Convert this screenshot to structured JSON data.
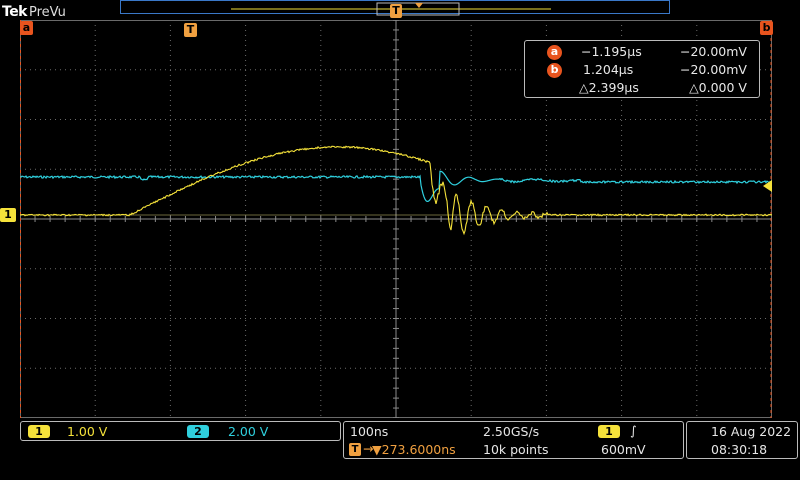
{
  "header": {
    "brand": "Tek",
    "mode": "PreVu"
  },
  "markers": {
    "cursor_a": "a",
    "cursor_b": "b",
    "trigger": "T",
    "ch1_ground": "1"
  },
  "cursors": {
    "a": {
      "label": "a",
      "time": "−1.195µs",
      "value": "−20.00mV"
    },
    "b": {
      "label": "b",
      "time": "1.204µs",
      "value": "−20.00mV"
    },
    "delta": {
      "time": "△2.399µs",
      "value": "△0.000 V"
    }
  },
  "channels": [
    {
      "id": "1",
      "scale": "1.00 V",
      "color": "#f5e23a"
    },
    {
      "id": "2",
      "scale": "2.00 V",
      "color": "#2fd0de"
    }
  ],
  "horizontal": {
    "time_per_div": "100ns",
    "sample_rate": "2.50GS/s",
    "trigger_pos": "▼273.6000ns",
    "record_length": "10k points"
  },
  "trigger": {
    "source": "1",
    "slope": "∫",
    "level": "600mV"
  },
  "datetime": {
    "date": "16 Aug 2022",
    "time": "08:30:18"
  },
  "colors": {
    "ch1": "#f5e23a",
    "ch2": "#2fd0de",
    "cursor": "#e8541e",
    "trigger_time": "#f0a040",
    "grid": "#6a6a6a",
    "record_frame": "#3a78c8"
  }
}
